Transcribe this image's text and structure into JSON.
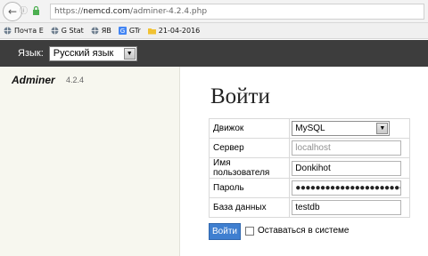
{
  "browser": {
    "url_prefix": "https://",
    "url_host": "nemcd.com",
    "url_path": "/adminer-4.2.4.php"
  },
  "bookmarks": [
    {
      "label": "Почта Е",
      "icon": "globe-icon"
    },
    {
      "label": "G Stat",
      "icon": "globe-icon"
    },
    {
      "label": "ЯВ",
      "icon": "globe-icon"
    },
    {
      "label": "GTr",
      "icon": "google-translate-icon"
    },
    {
      "label": "21-04-2016",
      "icon": "folder-icon"
    }
  ],
  "lang": {
    "label": "Язык:",
    "selected": "Русский язык"
  },
  "menu": {
    "brand": "Adminer",
    "version": "4.2.4"
  },
  "login": {
    "title": "Войти",
    "fields": {
      "driver_label": "Движок",
      "driver_value": "MySQL",
      "server_label": "Сервер",
      "server_placeholder": "localhost",
      "username_label": "Имя пользователя",
      "username_value": "Donkihot",
      "password_label": "Пароль",
      "password_mask": "●●●●●●●●●●●●●●●●●●●●●●●",
      "db_label": "База данных",
      "db_value": "testdb"
    },
    "submit_label": "Войти",
    "remember_label": "Оставаться в системе"
  },
  "colors": {
    "header_bg": "#3d3d3d",
    "menu_bg": "#f7f7ef",
    "button_bg": "#3f7fd0"
  }
}
